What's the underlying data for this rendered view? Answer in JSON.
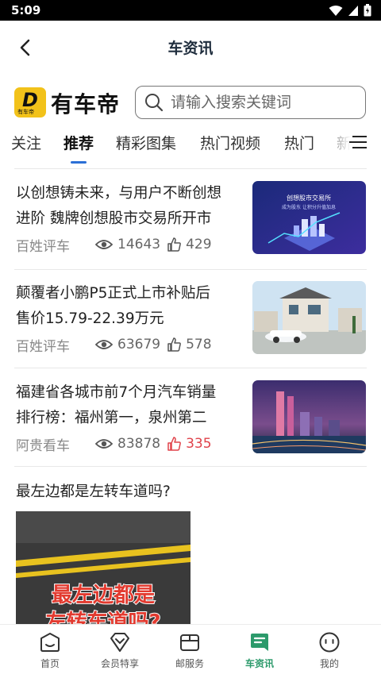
{
  "status": {
    "time": "5:09"
  },
  "header": {
    "title": "车资讯"
  },
  "brand": {
    "name": "有车帝",
    "badge_small": "有车帝"
  },
  "search": {
    "placeholder": "请输入搜索关键词"
  },
  "tabs": [
    {
      "label": "关注"
    },
    {
      "label": "推荐",
      "active": true
    },
    {
      "label": "精彩图集"
    },
    {
      "label": "热门视频"
    },
    {
      "label": "热门"
    },
    {
      "label": "新"
    }
  ],
  "articles": [
    {
      "line1": "以创想铸未来，与用户不断创想",
      "line2": "进阶 魏牌创想股市交易所开市",
      "source": "百姓评车",
      "views": "14643",
      "likes": "429",
      "liked": false,
      "thumb_title": "创想股市交易所",
      "thumb_sub": "成为股东 让积分升值加息"
    },
    {
      "line1": "颠覆者小鹏P5正式上市补贴后",
      "line2": "售价15.79-22.39万元",
      "source": "百姓评车",
      "views": "63679",
      "likes": "578",
      "liked": false
    },
    {
      "line1": "福建省各城市前7个月汽车销量",
      "line2": "排行榜：福州第一，泉州第二",
      "source": "阿贵看车",
      "views": "83878",
      "likes": "335",
      "liked": true
    }
  ],
  "article4": {
    "title": "最左边都是左转车道吗?",
    "video_text_1": "最左边都是",
    "video_text_2": "左转车道吗?"
  },
  "bottom_nav": [
    {
      "label": "首页"
    },
    {
      "label": "会员特享"
    },
    {
      "label": "邮服务"
    },
    {
      "label": "车资讯",
      "active": true
    },
    {
      "label": "我的"
    }
  ],
  "colors": {
    "accent_tab": "#2b6fd6",
    "nav_active": "#2c9a6b",
    "liked": "#e0424a",
    "logo_yellow": "#f2c21a"
  }
}
